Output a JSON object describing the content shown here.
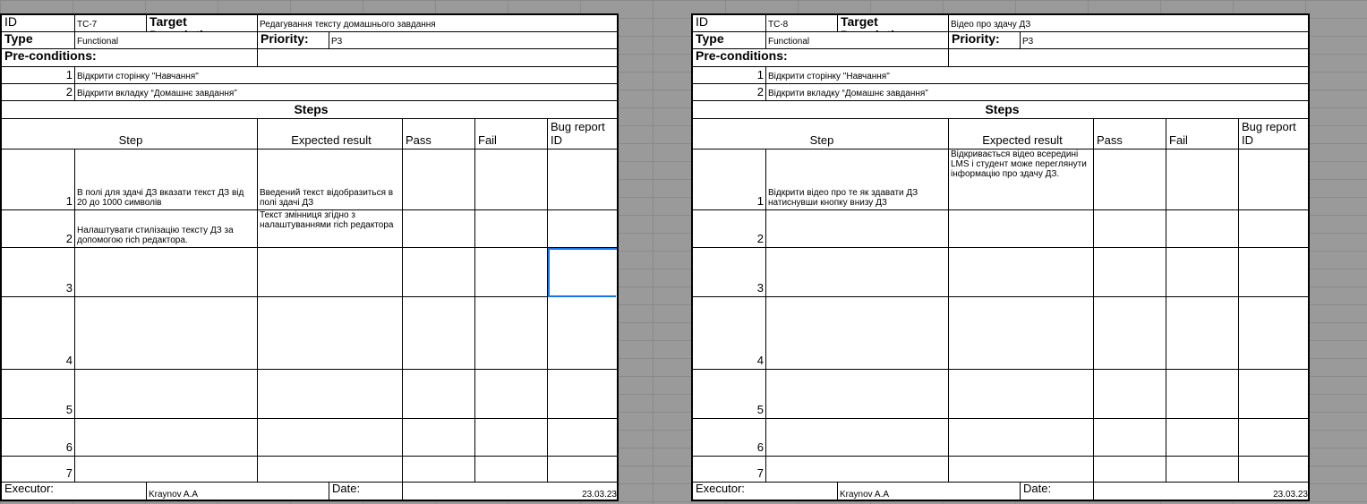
{
  "labels": {
    "id": "ID",
    "target_description": "Target Description:",
    "type": "Type",
    "priority": "Priority:",
    "preconditions": "Pre-conditions:",
    "steps_title": "Steps",
    "col_step": "Step",
    "col_expected": "Expected result",
    "col_pass": "Pass",
    "col_fail": "Fail",
    "col_bug": "Bug report ID",
    "executor": "Executor:",
    "date": "Date:"
  },
  "sheets": [
    {
      "id_value": "TC-7",
      "description": "Редагування тексту домашнього завдання",
      "type_value": "Functional",
      "priority_value": "P3",
      "preconditions": [
        {
          "n": "1",
          "text": "Відкрити сторінку \"Навчання\""
        },
        {
          "n": "2",
          "text": "Відкрити вкладку  “Домашнє завдання”"
        }
      ],
      "steps": [
        {
          "n": "1",
          "step": "В полі для здачі ДЗ вказати текст ДЗ від 20 до 1000 символів",
          "expected": "Введений текст відобразиться в полі здачі ДЗ"
        },
        {
          "n": "2",
          "step": " Налаштувати стилізацію тексту ДЗ за допомогою rich редактора.",
          "expected": "Текст змінниця згідно з налаштуваннями rich редактора"
        },
        {
          "n": "3",
          "step": "",
          "expected": ""
        },
        {
          "n": "4",
          "step": "",
          "expected": ""
        },
        {
          "n": "5",
          "step": "",
          "expected": ""
        },
        {
          "n": "6",
          "step": "",
          "expected": ""
        },
        {
          "n": "7",
          "step": "",
          "expected": ""
        }
      ],
      "executor_value": "Kraynov A.A",
      "date_value": "23.03.23"
    },
    {
      "id_value": "TC-8",
      "description": "Відео про здачу ДЗ",
      "type_value": "Functional",
      "priority_value": "P3",
      "preconditions": [
        {
          "n": "1",
          "text": "Відкрити сторінку \"Навчання\""
        },
        {
          "n": "2",
          "text": "Відкрити вкладку  “Домашнє завдання”"
        }
      ],
      "steps": [
        {
          "n": "1",
          "step": "Відкрити відео про те як здавати ДЗ натиснувши кнопку внизу ДЗ",
          "expected": "Відкривається відео всередині LMS і студент може переглянути інформацію про здачу ДЗ."
        },
        {
          "n": "2",
          "step": "",
          "expected": ""
        },
        {
          "n": "3",
          "step": "",
          "expected": ""
        },
        {
          "n": "4",
          "step": "",
          "expected": ""
        },
        {
          "n": "5",
          "step": "",
          "expected": ""
        },
        {
          "n": "6",
          "step": "",
          "expected": ""
        },
        {
          "n": "7",
          "step": "",
          "expected": ""
        }
      ],
      "executor_value": "Kraynov A.A",
      "date_value": "23.03.23"
    }
  ],
  "colors": {
    "selection": "#1a73e8",
    "background": "#9a9a9a"
  }
}
